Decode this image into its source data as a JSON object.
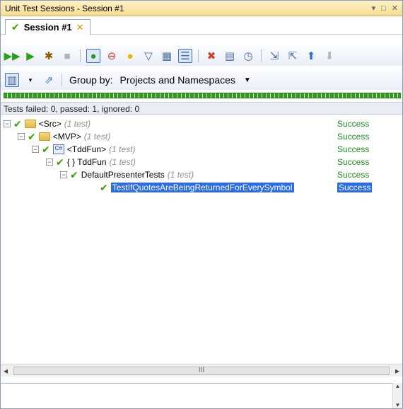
{
  "window": {
    "title": "Unit Test Sessions - Session #1",
    "title_icons": [
      "▾",
      "□",
      "✕"
    ]
  },
  "tabs": [
    {
      "label": "Session #1",
      "close": "✕"
    }
  ],
  "toolbar1": {
    "buttons": [
      "run-all-icon",
      "run-icon",
      "debug-icon",
      "stop-icon",
      "show-all-icon",
      "failed-filter-icon",
      "ignored-filter-icon",
      "filter-icon",
      "group-icon",
      "columns-icon",
      "remove-icon",
      "export-icon",
      "timer-icon",
      "collapse-icon",
      "expand-icon",
      "up-icon",
      "down-icon"
    ]
  },
  "toolbar2": {
    "groupby_label": "Group by:",
    "groupby_value": "Projects and Namespaces"
  },
  "status_text": "Tests failed: 0, passed: 1, ignored: 0",
  "tree": [
    {
      "label": "<Src>",
      "count": "(1 test)",
      "status": "Success"
    },
    {
      "label": "<MVP>",
      "count": "(1 test)",
      "status": "Success"
    },
    {
      "label": "<TddFun>",
      "count": "(1 test)",
      "status": "Success"
    },
    {
      "label": "{ } TddFun",
      "count": "(1 test)",
      "status": "Success"
    },
    {
      "label": "DefaultPresenterTests",
      "count": "(1 test)",
      "status": "Success"
    },
    {
      "label": "TestIfQuotesAreBeingReturnedForEverySymbol",
      "count": "",
      "status": "Success"
    }
  ],
  "colors": {
    "success": "#1d8c1d",
    "selection": "#2c6ce3",
    "progress": "#2f9c1c"
  }
}
